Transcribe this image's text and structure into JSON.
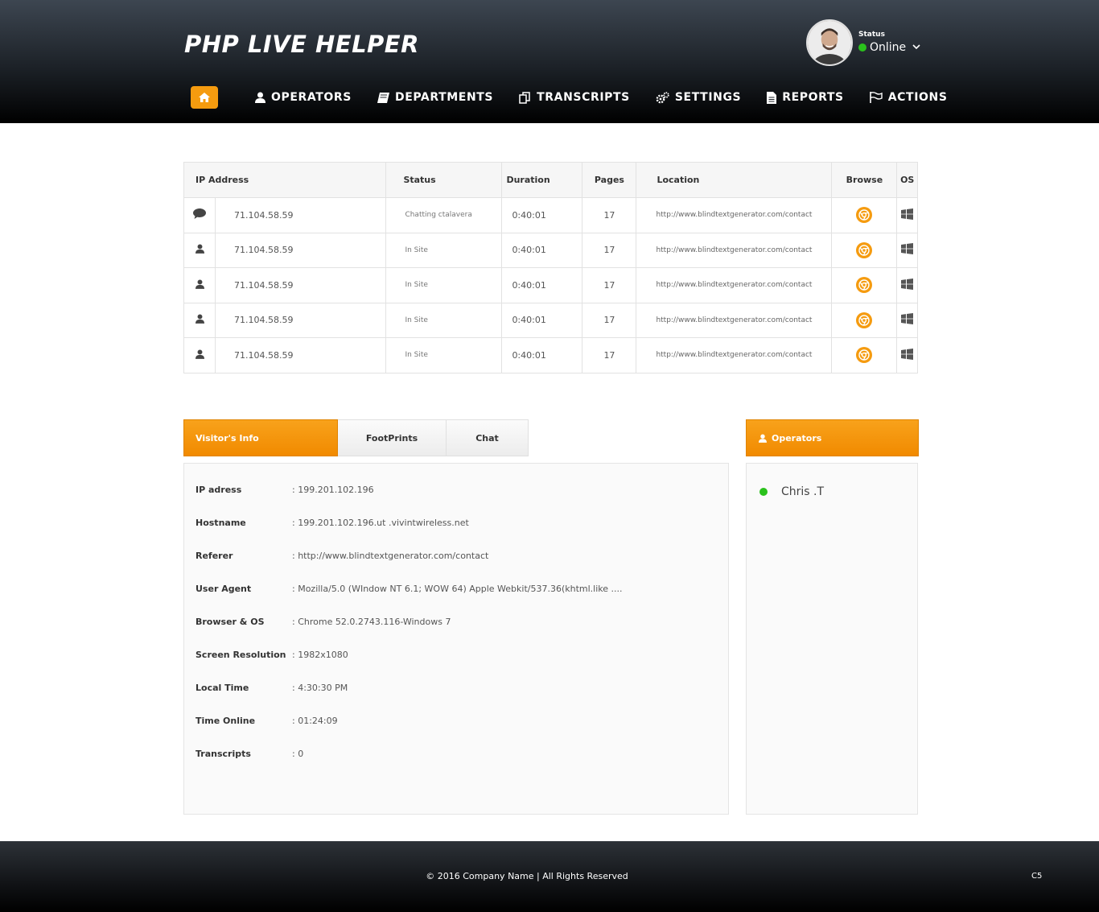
{
  "header": {
    "brand": "PHP LIVE HELPER",
    "status_label": "Status",
    "status_value": "Online"
  },
  "nav": {
    "home_icon": "home-icon",
    "items": [
      {
        "label": "OPERATORS",
        "icon": "user-icon"
      },
      {
        "label": "DEPARTMENTS",
        "icon": "book-icon"
      },
      {
        "label": "TRANSCRIPTS",
        "icon": "copy-icon"
      },
      {
        "label": "SETTINGS",
        "icon": "gears-icon"
      },
      {
        "label": "REPORTS",
        "icon": "file-icon"
      },
      {
        "label": "ACTIONS",
        "icon": "flag-icon"
      }
    ]
  },
  "visitors": {
    "columns": [
      "IP Address",
      "Status",
      "Duration",
      "Pages",
      "Location",
      "Browse",
      "OS"
    ],
    "rows": [
      {
        "icon": "chat-icon",
        "ip": "71.104.58.59",
        "status": "Chatting ctalavera",
        "duration": "0:40:01",
        "pages": "17",
        "location": "http://www.blindtextgenerator.com/contact",
        "browser": "chrome-icon",
        "os": "windows-icon"
      },
      {
        "icon": "user-icon",
        "ip": "71.104.58.59",
        "status": "In Site",
        "duration": "0:40:01",
        "pages": "17",
        "location": "http://www.blindtextgenerator.com/contact",
        "browser": "chrome-icon",
        "os": "windows-icon"
      },
      {
        "icon": "user-icon",
        "ip": "71.104.58.59",
        "status": "In Site",
        "duration": "0:40:01",
        "pages": "17",
        "location": "http://www.blindtextgenerator.com/contact",
        "browser": "chrome-icon",
        "os": "windows-icon"
      },
      {
        "icon": "user-icon",
        "ip": "71.104.58.59",
        "status": "In Site",
        "duration": "0:40:01",
        "pages": "17",
        "location": "http://www.blindtextgenerator.com/contact",
        "browser": "chrome-icon",
        "os": "windows-icon"
      },
      {
        "icon": "user-icon",
        "ip": "71.104.58.59",
        "status": "In Site",
        "duration": "0:40:01",
        "pages": "17",
        "location": "http://www.blindtextgenerator.com/contact",
        "browser": "chrome-icon",
        "os": "windows-icon"
      }
    ]
  },
  "tabs": {
    "visitor_info": "Visitor's Info",
    "footprints": "FootPrints",
    "chat": "Chat"
  },
  "visitor_info": [
    {
      "key": "IP adress",
      "value": ": 199.201.102.196"
    },
    {
      "key": "Hostname",
      "value": ":   199.201.102.196.ut .vivintwireless.net"
    },
    {
      "key": "Referer",
      "value": ":  http://www.blindtextgenerator.com/contact"
    },
    {
      "key": "User Agent",
      "value": ": Mozilla/5.0 (WIndow NT 6.1; WOW 64) Apple Webkit/537.36(khtml.like  ...."
    },
    {
      "key": "Browser & OS",
      "value": ": Chrome 52.0.2743.116-Windows 7"
    },
    {
      "key": "Screen Resolution",
      "value": ": 1982x1080"
    },
    {
      "key": "Local Time",
      "value": ": 4:30:30 PM"
    },
    {
      "key": "Time Online",
      "value": ": 01:24:09"
    },
    {
      "key": "Transcripts",
      "value": ": 0"
    }
  ],
  "operators": {
    "title": "Operators",
    "list": [
      {
        "name": "Chris .T",
        "status_color": "#2ac11c"
      }
    ]
  },
  "footer": {
    "copyright": "© 2016 Company Name  | All Rights Reserved",
    "code": "C5"
  },
  "colors": {
    "accent": "#f59b0f",
    "online": "#2ac11c"
  }
}
